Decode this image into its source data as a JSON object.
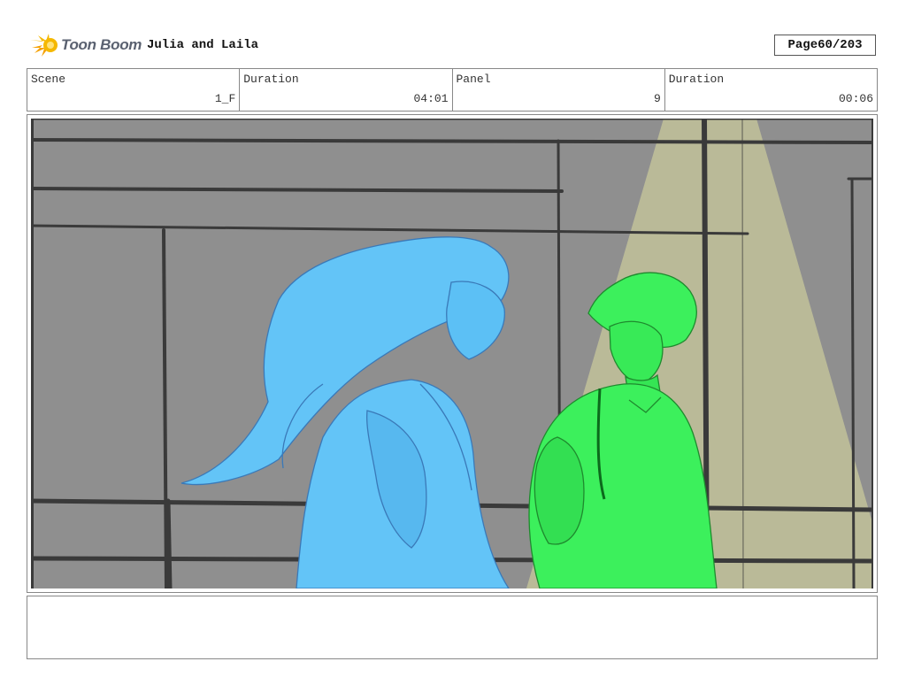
{
  "header": {
    "logo_text": "Toon Boom",
    "project_title": "Julia and Laila",
    "page_label": "Page",
    "page_value": "60/203"
  },
  "info": {
    "scene_label": "Scene",
    "scene_value": "1_F",
    "scene_duration_label": "Duration",
    "scene_duration_value": "04:01",
    "panel_label": "Panel",
    "panel_value": "9",
    "panel_duration_label": "Duration",
    "panel_duration_value": "00:06"
  },
  "colors": {
    "girl_fill": "#63c4f7",
    "boy_fill": "#3cf05c",
    "background": "#8f8f8f",
    "spotlight": "#c2c29a",
    "logo_star": "#f5b800"
  },
  "notes": ""
}
